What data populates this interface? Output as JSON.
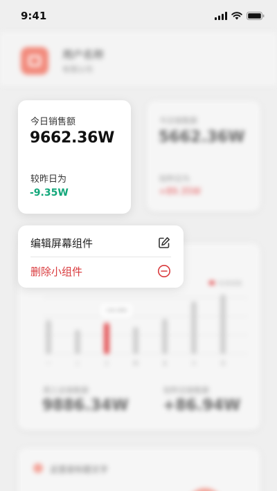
{
  "status": {
    "time": "9:41"
  },
  "header": {
    "user_name": "用户名称",
    "user_sub": "有限公司"
  },
  "sales_card": {
    "label": "今日销售额",
    "value": "9662.36W",
    "compare_label": "较昨日为",
    "compare_value": "-9.35W"
  },
  "blur_card": {
    "label": "今日销售额",
    "value": "5662.36W",
    "compare_label": "较昨日为",
    "compare_value": "+89.35W"
  },
  "context_menu": {
    "edit_label": "编辑屏幕组件",
    "delete_label": "删除小组件"
  },
  "chart_card": {
    "legend": "本周销售",
    "tooltip": "136.36W",
    "stat_left_label": "周三总销售额",
    "stat_left_value": "9886.34W",
    "stat_right_label": "较昨日销售额",
    "stat_right_value": "+86.94W"
  },
  "chart_data": {
    "type": "bar",
    "categories": [
      "一",
      "二",
      "三",
      "四",
      "五",
      "六",
      "日"
    ],
    "values": [
      48,
      34,
      44,
      38,
      50,
      74,
      84
    ],
    "highlight_index": 2,
    "ylim": [
      0,
      90
    ],
    "grid": true
  },
  "bottom_card": {
    "title": "这里是标题文字"
  },
  "colors": {
    "accent": "#d9393c",
    "positive": "#12a77a",
    "bar": "#cfcfcf",
    "bar_highlight": "#e4585a"
  }
}
